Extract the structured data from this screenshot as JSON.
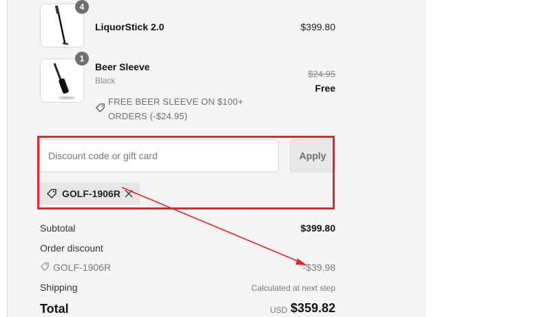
{
  "items": [
    {
      "name": "LiquorStick 2.0",
      "quantity": "4",
      "price": "$399.80",
      "icon": "putter-icon"
    },
    {
      "name": "Beer Sleeve",
      "quantity": "1",
      "variant": "Black",
      "original_price": "$24.95",
      "price": "Free",
      "promo_text": "FREE BEER SLEEVE ON $100+ ORDERS (-$24.95)",
      "icon": "putter-icon"
    }
  ],
  "discount": {
    "placeholder": "Discount code or gift card",
    "value": "",
    "apply_label": "Apply",
    "applied_code": "GOLF-1906R"
  },
  "summary": {
    "subtotal_label": "Subtotal",
    "subtotal_value": "$399.80",
    "order_discount_label": "Order discount",
    "discount_code": "GOLF-1906R",
    "discount_value": "-$39.98",
    "shipping_label": "Shipping",
    "shipping_value": "Calculated at next step",
    "total_label": "Total",
    "currency": "USD",
    "total_value": "$359.82"
  },
  "colors": {
    "panel_bg": "#f4f4f4",
    "highlight_annotation": "#e8232b",
    "badge_bg": "#6f6f6f"
  }
}
